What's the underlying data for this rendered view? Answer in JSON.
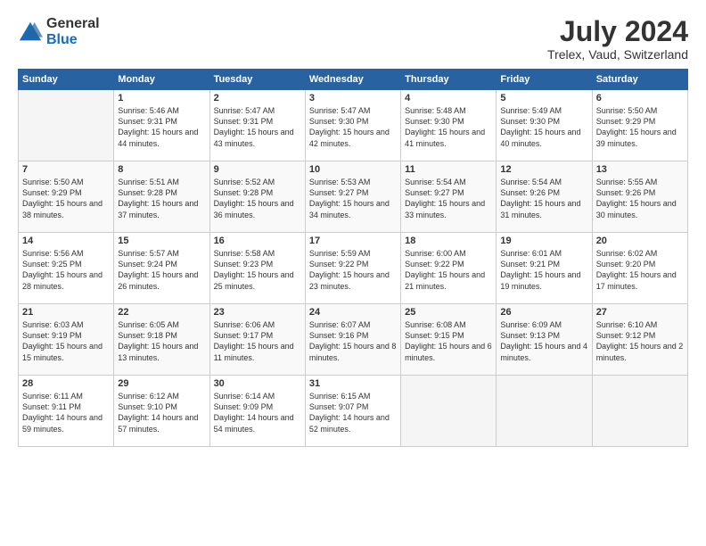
{
  "logo": {
    "general": "General",
    "blue": "Blue"
  },
  "title": "July 2024",
  "subtitle": "Trelex, Vaud, Switzerland",
  "headers": [
    "Sunday",
    "Monday",
    "Tuesday",
    "Wednesday",
    "Thursday",
    "Friday",
    "Saturday"
  ],
  "weeks": [
    [
      {
        "day": "",
        "empty": true
      },
      {
        "day": "1",
        "sunrise": "Sunrise: 5:46 AM",
        "sunset": "Sunset: 9:31 PM",
        "daylight": "Daylight: 15 hours and 44 minutes."
      },
      {
        "day": "2",
        "sunrise": "Sunrise: 5:47 AM",
        "sunset": "Sunset: 9:31 PM",
        "daylight": "Daylight: 15 hours and 43 minutes."
      },
      {
        "day": "3",
        "sunrise": "Sunrise: 5:47 AM",
        "sunset": "Sunset: 9:30 PM",
        "daylight": "Daylight: 15 hours and 42 minutes."
      },
      {
        "day": "4",
        "sunrise": "Sunrise: 5:48 AM",
        "sunset": "Sunset: 9:30 PM",
        "daylight": "Daylight: 15 hours and 41 minutes."
      },
      {
        "day": "5",
        "sunrise": "Sunrise: 5:49 AM",
        "sunset": "Sunset: 9:30 PM",
        "daylight": "Daylight: 15 hours and 40 minutes."
      },
      {
        "day": "6",
        "sunrise": "Sunrise: 5:50 AM",
        "sunset": "Sunset: 9:29 PM",
        "daylight": "Daylight: 15 hours and 39 minutes."
      }
    ],
    [
      {
        "day": "7",
        "sunrise": "Sunrise: 5:50 AM",
        "sunset": "Sunset: 9:29 PM",
        "daylight": "Daylight: 15 hours and 38 minutes."
      },
      {
        "day": "8",
        "sunrise": "Sunrise: 5:51 AM",
        "sunset": "Sunset: 9:28 PM",
        "daylight": "Daylight: 15 hours and 37 minutes."
      },
      {
        "day": "9",
        "sunrise": "Sunrise: 5:52 AM",
        "sunset": "Sunset: 9:28 PM",
        "daylight": "Daylight: 15 hours and 36 minutes."
      },
      {
        "day": "10",
        "sunrise": "Sunrise: 5:53 AM",
        "sunset": "Sunset: 9:27 PM",
        "daylight": "Daylight: 15 hours and 34 minutes."
      },
      {
        "day": "11",
        "sunrise": "Sunrise: 5:54 AM",
        "sunset": "Sunset: 9:27 PM",
        "daylight": "Daylight: 15 hours and 33 minutes."
      },
      {
        "day": "12",
        "sunrise": "Sunrise: 5:54 AM",
        "sunset": "Sunset: 9:26 PM",
        "daylight": "Daylight: 15 hours and 31 minutes."
      },
      {
        "day": "13",
        "sunrise": "Sunrise: 5:55 AM",
        "sunset": "Sunset: 9:26 PM",
        "daylight": "Daylight: 15 hours and 30 minutes."
      }
    ],
    [
      {
        "day": "14",
        "sunrise": "Sunrise: 5:56 AM",
        "sunset": "Sunset: 9:25 PM",
        "daylight": "Daylight: 15 hours and 28 minutes."
      },
      {
        "day": "15",
        "sunrise": "Sunrise: 5:57 AM",
        "sunset": "Sunset: 9:24 PM",
        "daylight": "Daylight: 15 hours and 26 minutes."
      },
      {
        "day": "16",
        "sunrise": "Sunrise: 5:58 AM",
        "sunset": "Sunset: 9:23 PM",
        "daylight": "Daylight: 15 hours and 25 minutes."
      },
      {
        "day": "17",
        "sunrise": "Sunrise: 5:59 AM",
        "sunset": "Sunset: 9:22 PM",
        "daylight": "Daylight: 15 hours and 23 minutes."
      },
      {
        "day": "18",
        "sunrise": "Sunrise: 6:00 AM",
        "sunset": "Sunset: 9:22 PM",
        "daylight": "Daylight: 15 hours and 21 minutes."
      },
      {
        "day": "19",
        "sunrise": "Sunrise: 6:01 AM",
        "sunset": "Sunset: 9:21 PM",
        "daylight": "Daylight: 15 hours and 19 minutes."
      },
      {
        "day": "20",
        "sunrise": "Sunrise: 6:02 AM",
        "sunset": "Sunset: 9:20 PM",
        "daylight": "Daylight: 15 hours and 17 minutes."
      }
    ],
    [
      {
        "day": "21",
        "sunrise": "Sunrise: 6:03 AM",
        "sunset": "Sunset: 9:19 PM",
        "daylight": "Daylight: 15 hours and 15 minutes."
      },
      {
        "day": "22",
        "sunrise": "Sunrise: 6:05 AM",
        "sunset": "Sunset: 9:18 PM",
        "daylight": "Daylight: 15 hours and 13 minutes."
      },
      {
        "day": "23",
        "sunrise": "Sunrise: 6:06 AM",
        "sunset": "Sunset: 9:17 PM",
        "daylight": "Daylight: 15 hours and 11 minutes."
      },
      {
        "day": "24",
        "sunrise": "Sunrise: 6:07 AM",
        "sunset": "Sunset: 9:16 PM",
        "daylight": "Daylight: 15 hours and 8 minutes."
      },
      {
        "day": "25",
        "sunrise": "Sunrise: 6:08 AM",
        "sunset": "Sunset: 9:15 PM",
        "daylight": "Daylight: 15 hours and 6 minutes."
      },
      {
        "day": "26",
        "sunrise": "Sunrise: 6:09 AM",
        "sunset": "Sunset: 9:13 PM",
        "daylight": "Daylight: 15 hours and 4 minutes."
      },
      {
        "day": "27",
        "sunrise": "Sunrise: 6:10 AM",
        "sunset": "Sunset: 9:12 PM",
        "daylight": "Daylight: 15 hours and 2 minutes."
      }
    ],
    [
      {
        "day": "28",
        "sunrise": "Sunrise: 6:11 AM",
        "sunset": "Sunset: 9:11 PM",
        "daylight": "Daylight: 14 hours and 59 minutes."
      },
      {
        "day": "29",
        "sunrise": "Sunrise: 6:12 AM",
        "sunset": "Sunset: 9:10 PM",
        "daylight": "Daylight: 14 hours and 57 minutes."
      },
      {
        "day": "30",
        "sunrise": "Sunrise: 6:14 AM",
        "sunset": "Sunset: 9:09 PM",
        "daylight": "Daylight: 14 hours and 54 minutes."
      },
      {
        "day": "31",
        "sunrise": "Sunrise: 6:15 AM",
        "sunset": "Sunset: 9:07 PM",
        "daylight": "Daylight: 14 hours and 52 minutes."
      },
      {
        "day": "",
        "empty": true
      },
      {
        "day": "",
        "empty": true
      },
      {
        "day": "",
        "empty": true
      }
    ]
  ]
}
